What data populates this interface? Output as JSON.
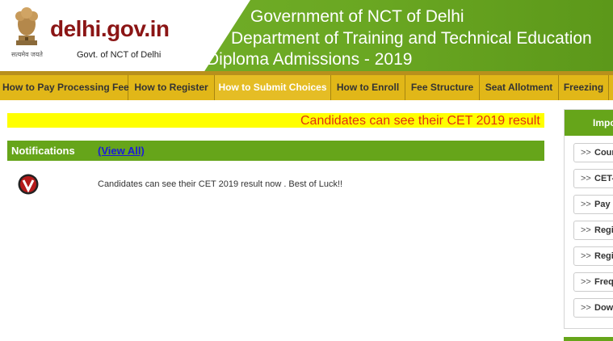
{
  "header": {
    "site_name": "delhi.gov.in",
    "site_subtitle": "Govt. of NCT of Delhi",
    "emblem_motto": "सत्यमेव जयते",
    "title_line1": "Government of NCT of Delhi",
    "title_line2": "Department of Training and Technical Education",
    "title_line3": "Diploma Admissions - 2019"
  },
  "nav": {
    "items": [
      {
        "label": "How to Pay Processing Fee"
      },
      {
        "label": "How to Register"
      },
      {
        "label": "How to Submit Choices"
      },
      {
        "label": "How to Enroll"
      },
      {
        "label": "Fee Structure"
      },
      {
        "label": "Seat Allotment"
      },
      {
        "label": "Freezing"
      }
    ]
  },
  "marquee": {
    "text": "Candidates can see their CET 2019 result r"
  },
  "notifications": {
    "title": "Notifications",
    "view_all": "(View All)",
    "items": [
      {
        "text": "Candidates can see their CET 2019 result now . Best of Luck!!"
      }
    ]
  },
  "right_panel": {
    "heading": "Impo",
    "items": [
      {
        "label": "Cour"
      },
      {
        "label": "CET-"
      },
      {
        "label": "Pay"
      },
      {
        "label": "Regi"
      },
      {
        "label": "Regi"
      },
      {
        "label": "Freq"
      },
      {
        "label": "Dow"
      }
    ]
  },
  "colors": {
    "header_green": "#6aa722",
    "nav_gold": "#e1b718",
    "marquee_yellow": "#ffff00",
    "marquee_text": "#e03010",
    "brand_red": "#8b1515"
  }
}
